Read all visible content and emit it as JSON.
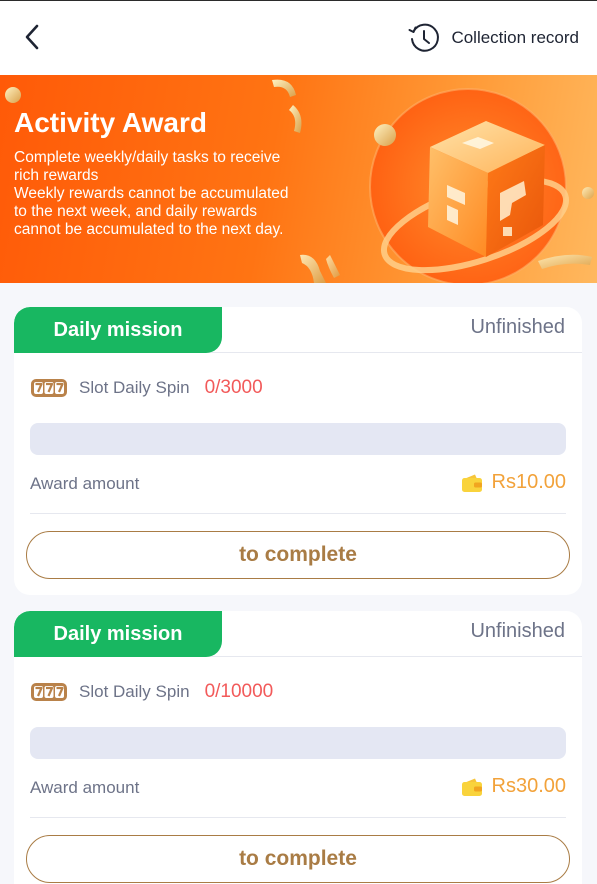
{
  "header": {
    "collection_record_label": "Collection record"
  },
  "banner": {
    "title": "Activity Award",
    "description_lines": [
      "Complete weekly/daily tasks to receive",
      "rich rewards",
      "Weekly rewards cannot be accumulated",
      "to the next week, and daily rewards",
      "cannot be accumulated to the next day."
    ]
  },
  "missions": [
    {
      "tag": "Daily mission",
      "status": "Unfinished",
      "task_name": "Slot Daily Spin",
      "progress": "0/3000",
      "progress_fraction": 0,
      "award_label": "Award amount",
      "award_amount": "Rs10.00",
      "button_label": "to complete"
    },
    {
      "tag": "Daily mission",
      "status": "Unfinished",
      "task_name": "Slot Daily Spin",
      "progress": "0/10000",
      "progress_fraction": 0,
      "award_label": "Award amount",
      "award_amount": "Rs30.00",
      "button_label": "to complete"
    }
  ],
  "icons": {
    "back": "chevron-left-icon",
    "record": "history-clock-icon",
    "slot": "slot-777-icon",
    "wallet": "wallet-icon",
    "banner_art": "mystery-cube-illustration"
  },
  "colors": {
    "banner_gradient_start": "#ff5a08",
    "banner_gradient_end": "#ffb85e",
    "tag_green": "#18b761",
    "progress_red": "#f25a5a",
    "award_orange": "#f2a23a",
    "button_brown": "#a97c45",
    "progress_track": "#e4e7f3"
  }
}
